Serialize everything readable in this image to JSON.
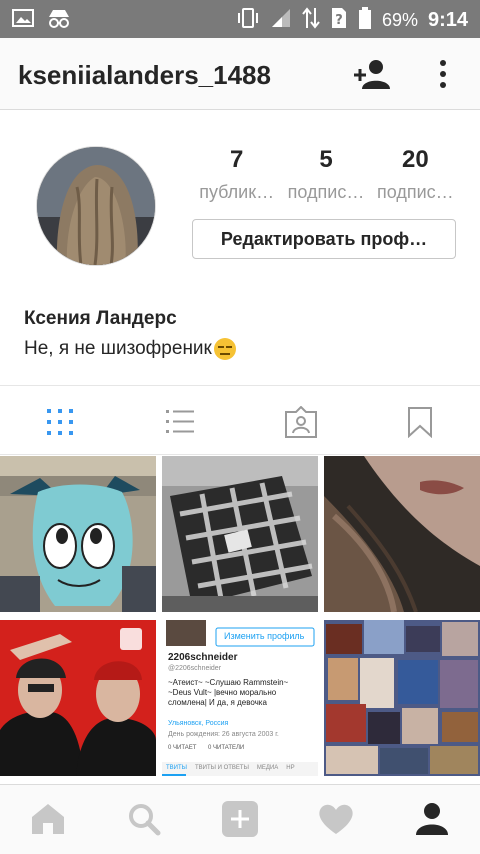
{
  "status_bar": {
    "battery_percent": "69%",
    "time": "9:14",
    "icons": [
      "image-icon",
      "incognito-icon",
      "vibrate-icon",
      "signal-icon",
      "data-arrows-icon",
      "sim-unknown-icon",
      "battery-icon"
    ]
  },
  "header": {
    "username": "kseniialanders_1488",
    "icons": [
      "add-user-icon",
      "more-vertical-icon"
    ]
  },
  "profile": {
    "stats": [
      {
        "value": "7",
        "label": "публик…"
      },
      {
        "value": "5",
        "label": "подпис…"
      },
      {
        "value": "20",
        "label": "подпис…"
      }
    ],
    "edit_button": "Редактировать проф…",
    "full_name": "Ксения Ландерс",
    "bio": "Не, я не шизофреник"
  },
  "tabs": [
    "grid-icon",
    "list-icon",
    "tagged-icon",
    "saved-icon"
  ],
  "grid": {
    "cells": [
      "cartoon-robot-girl",
      "plaid-blanket-chair",
      "portrait-lips-hair",
      "two-men-red-background",
      "profile-screenshot",
      "poster-collage"
    ],
    "screenshot": {
      "username": "2206schneider",
      "handle": "@2206schneider",
      "edit_button": "Изменить профиль",
      "bio": "~Атеист~ ~Слушаю Rammstein~ ~Deus Vult~ |вечно морально сломлена| И да, я девочка",
      "location": "Ульяновск, Россия",
      "birthday": "День рождения: 26 августа 2003 г.",
      "following": "0 ЧИТАЕТ",
      "followers": "0 ЧИТАТЕЛИ",
      "tabs": [
        "ТВИТЫ",
        "ТВИТЫ И ОТВЕТЫ",
        "МЕДИА",
        "НР"
      ]
    }
  },
  "bottom_nav": [
    "home-icon",
    "search-icon",
    "add-post-icon",
    "activity-heart-icon",
    "profile-icon"
  ]
}
